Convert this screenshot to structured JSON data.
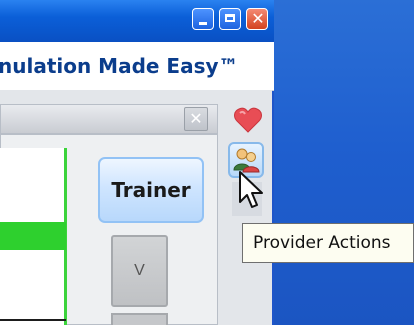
{
  "desktop": {
    "color": "#1f5fcf"
  },
  "window": {
    "titlebar_color": "#0a50c3",
    "controls": {
      "minimize_icon": "minimize-icon",
      "maximize_icon": "maximize-icon",
      "close_icon": "close-icon",
      "close_glyph": "✕"
    },
    "tagline": "nulation Made Easy™"
  },
  "panel": {
    "close_glyph": "✕",
    "green_color": "#2ed02e"
  },
  "buttons": {
    "trainer_label": "Trainer",
    "v_label": "V"
  },
  "toolstrip": {
    "favorite_icon": "heart-icon",
    "provider_icon": "people-icon"
  },
  "tooltip": {
    "text": "Provider Actions"
  }
}
